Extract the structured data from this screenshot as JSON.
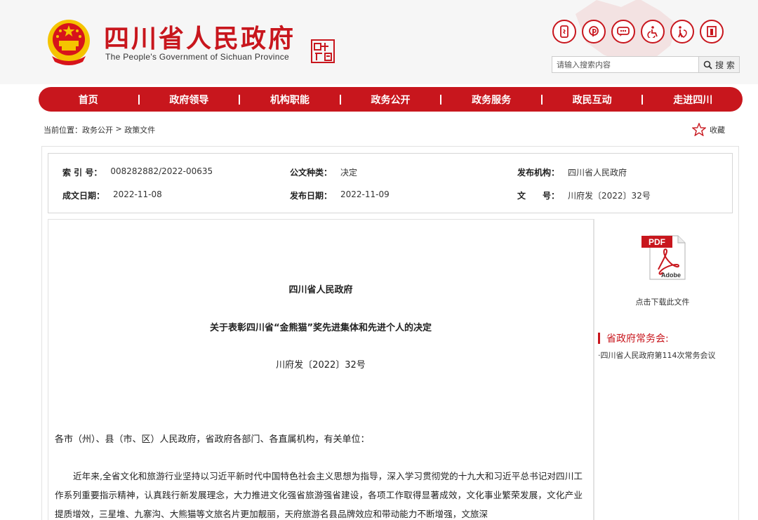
{
  "header": {
    "title": "四川省人民政府",
    "subtitle": "The People's Government of Sichuan Province",
    "icons": [
      "mobile-icon",
      "weibo-icon",
      "wechat-icon",
      "accessibility-icon",
      "elderly-care-icon",
      "login-icon"
    ],
    "search": {
      "placeholder": "请输入搜索内容",
      "button_label": "搜 索"
    }
  },
  "nav": {
    "items": [
      {
        "label": "首页"
      },
      {
        "label": "政府领导"
      },
      {
        "label": "机构职能"
      },
      {
        "label": "政务公开"
      },
      {
        "label": "政务服务"
      },
      {
        "label": "政民互动"
      },
      {
        "label": "走进四川"
      }
    ]
  },
  "breadcrumb": {
    "prefix": "当前位置：",
    "crumb1": "政务公开",
    "sep": " > ",
    "crumb2": "政策文件"
  },
  "favorite": {
    "label": "收藏"
  },
  "info": {
    "index_key": "索 引 号：",
    "index_val": "008282882/2022-00635",
    "type_key": "公文种类：",
    "type_val": "决定",
    "org_key": "发布机构：",
    "org_val": "四川省人民政府",
    "created_key": "成文日期：",
    "created_val": "2022-11-08",
    "published_key": "发布日期：",
    "published_val": "2022-11-09",
    "docnum_key": "文　　号：",
    "docnum_val": "川府发〔2022〕32号"
  },
  "document": {
    "org": "四川省人民政府",
    "title": "关于表彰四川省“金熊猫”奖先进集体和先进个人的决定",
    "number": "川府发〔2022〕32号",
    "addressee": "各市（州）、县（市、区）人民政府，省政府各部门、各直属机构，有关单位：",
    "body": "近年来,全省文化和旅游行业坚持以习近平新时代中国特色社会主义思想为指导，深入学习贯彻党的十九大和习近平总书记对四川工作系列重要指示精神，认真践行新发展理念，大力推进文化强省旅游强省建设，各项工作取得显著成效，文化事业繁荣发展，文化产业提质增效，三星堆、九寨沟、大熊猫等文旅名片更加靓丽，天府旅游名县品牌效应和带动能力不断增强，文旅深"
  },
  "sidebar": {
    "pdf_label": "点击下载此文件",
    "pdf_badge": "PDF",
    "pdf_brand": "Adobe",
    "section_title": "省政府常务会:",
    "section_link": "·四川省人民政府第114次常务会议"
  },
  "colors": {
    "brand_red": "#c8161d",
    "gold": "#f5c400"
  }
}
